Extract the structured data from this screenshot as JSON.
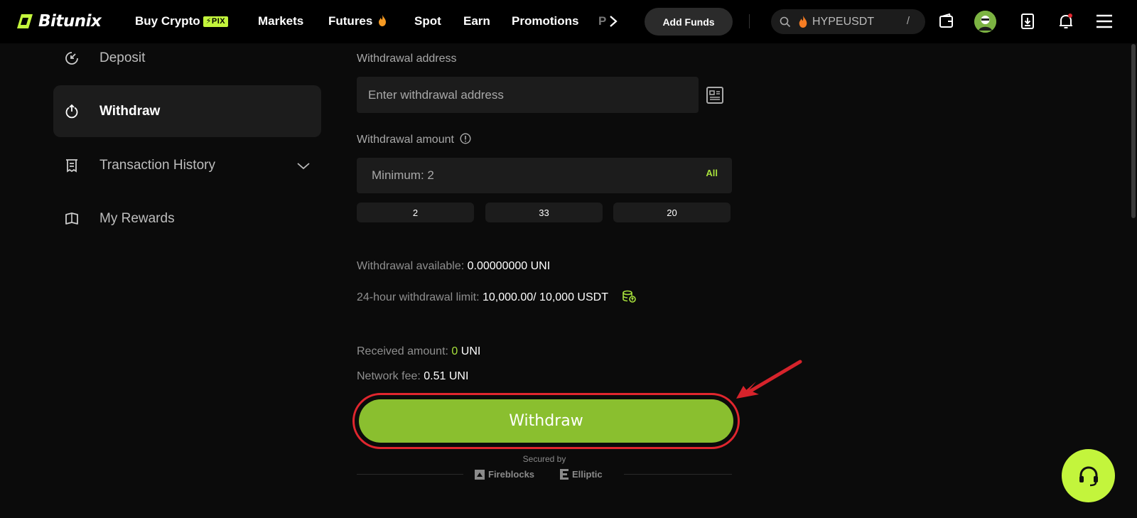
{
  "brand": {
    "name": "Bitunix",
    "accent": "#c3f53c",
    "button_green": "#8abf2f",
    "highlight_red": "#e0262e"
  },
  "nav": {
    "items": [
      {
        "label": "Buy Crypto",
        "badge": "PIX"
      },
      {
        "label": "Markets"
      },
      {
        "label": "Futures",
        "icon": "flame-icon"
      },
      {
        "label": "Spot"
      },
      {
        "label": "Earn"
      },
      {
        "label": "Promotions"
      }
    ],
    "truncated_label": "P",
    "add_funds": "Add Funds",
    "search": {
      "value": "HYPEUSDT",
      "shortcut": "/"
    },
    "icons": [
      "wallet-icon",
      "avatar",
      "download-icon",
      "bell-icon",
      "menu-icon"
    ]
  },
  "sidebar": {
    "items": [
      {
        "label": "Deposit",
        "icon": "deposit-icon",
        "active": false
      },
      {
        "label": "Withdraw",
        "icon": "withdraw-icon",
        "active": true
      },
      {
        "label": "Transaction History",
        "icon": "receipt-icon",
        "active": false,
        "expandable": true
      },
      {
        "label": "My Rewards",
        "icon": "rewards-icon",
        "active": false
      }
    ]
  },
  "form": {
    "address_label": "Withdrawal address",
    "address_placeholder": "Enter withdrawal address",
    "amount_label": "Withdrawal amount",
    "amount_placeholder": "Minimum: 2",
    "all_label": "All",
    "quick_amounts": [
      "2",
      "33",
      "20"
    ],
    "available_label": "Withdrawal available:",
    "available_value": "0.00000000 UNI",
    "limit_label": "24-hour withdrawal limit:",
    "limit_value": "10,000.00/ 10,000 USDT",
    "received_label": "Received amount:",
    "received_value": "0",
    "received_unit": "UNI",
    "fee_label": "Network fee:",
    "fee_value": "0.51 UNI",
    "submit_label": "Withdraw",
    "secured_by": "Secured by",
    "partners": [
      "Fireblocks",
      "Elliptic"
    ]
  }
}
